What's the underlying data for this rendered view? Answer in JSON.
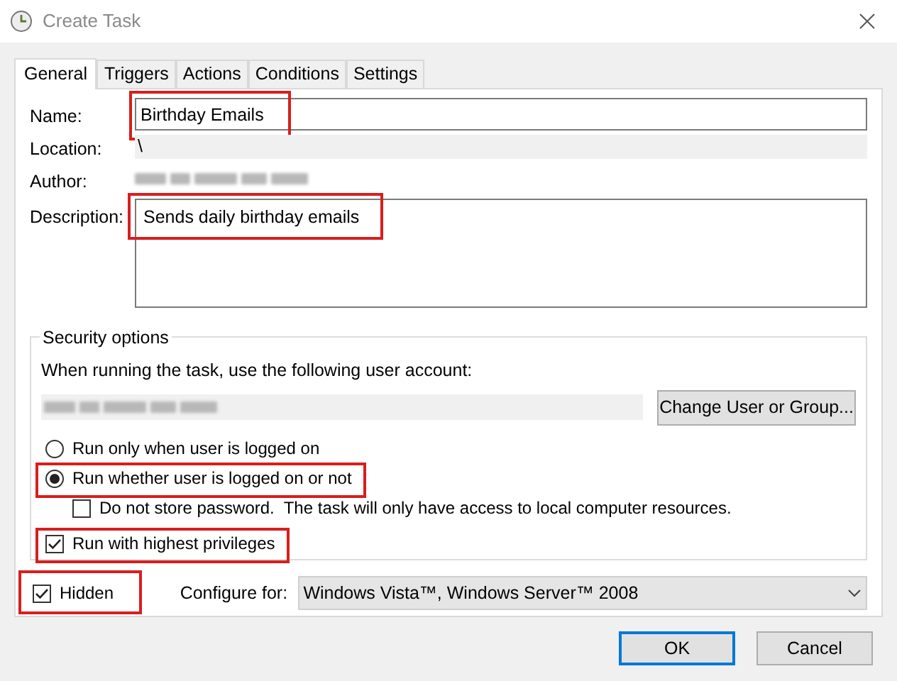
{
  "window": {
    "title": "Create Task"
  },
  "tabs": [
    {
      "label": "General",
      "selected": true
    },
    {
      "label": "Triggers",
      "selected": false
    },
    {
      "label": "Actions",
      "selected": false
    },
    {
      "label": "Conditions",
      "selected": false
    },
    {
      "label": "Settings",
      "selected": false
    }
  ],
  "fields": [
    {
      "label": "Name:",
      "kind": "text",
      "value": "Birthday Emails",
      "highlighted": true
    },
    {
      "label": "Location:",
      "kind": "readonly",
      "value": "\\",
      "highlighted": false
    },
    {
      "label": "Author:",
      "kind": "redacted",
      "highlighted": false
    },
    {
      "label": "Description:",
      "kind": "textarea",
      "value": "Sends daily birthday emails",
      "highlighted": true
    }
  ],
  "security": {
    "title": "Security options",
    "account_prompt": "When running the task, use the following user account:",
    "change_button": "Change User or Group...",
    "options": [
      {
        "kind": "radio",
        "label": "Run only when user is logged on",
        "selected": false,
        "indented": false,
        "highlighted": false
      },
      {
        "kind": "radio",
        "label": "Run whether user is logged on or not",
        "selected": true,
        "indented": false,
        "highlighted": true
      },
      {
        "kind": "checkbox",
        "label": "Do not store password.  The task will only have access to local computer resources.",
        "checked": false,
        "indented": true,
        "highlighted": false
      },
      {
        "kind": "checkbox",
        "label": "Run with highest privileges",
        "checked": true,
        "indented": false,
        "highlighted": true
      }
    ]
  },
  "hidden": {
    "label": "Hidden",
    "checked": true,
    "highlighted": true
  },
  "configure": {
    "label": "Configure for:",
    "value": "Windows Vista™, Windows Server™ 2008"
  },
  "buttons": [
    {
      "label": "OK",
      "default": true
    },
    {
      "label": "Cancel",
      "default": false
    }
  ]
}
